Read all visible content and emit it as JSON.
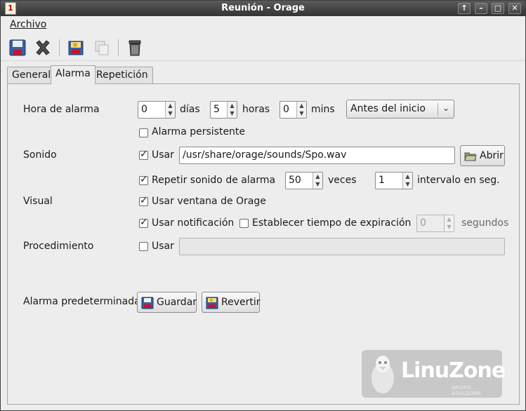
{
  "window": {
    "title": "Reunión - Orage"
  },
  "menubar": {
    "archivo": "Archivo"
  },
  "toolbar": {
    "items": [
      "save-icon",
      "delete-icon",
      "duplicate-icon",
      "copy-icon",
      "trash-icon"
    ]
  },
  "tabs": [
    {
      "label": "General"
    },
    {
      "label": "Alarma"
    },
    {
      "label": "Repetición"
    }
  ],
  "alarm": {
    "hora_label": "Hora de alarma",
    "dias_value": "0",
    "dias_unit": "días",
    "horas_value": "5",
    "horas_unit": "horas",
    "mins_value": "0",
    "mins_unit": "mins",
    "when_option": "Antes del inicio",
    "persistente_label": "Alarma persistente"
  },
  "sound": {
    "label": "Sonido",
    "usar_label": "Usar",
    "file_path": "/usr/share/orage/sounds/Spo.wav",
    "abrir_label": "Abrir",
    "repeat_label": "Repetir sonido de alarma",
    "repeat_count": "50",
    "veces_label": "veces",
    "interval_value": "1",
    "interval_label": "intervalo en seg."
  },
  "visual": {
    "label": "Visual",
    "ventana_label": "Usar ventana de Orage",
    "notificacion_label": "Usar notificación",
    "expiracion_label": "Establecer tiempo de expiración",
    "expiracion_value": "0",
    "segundos_label": "segundos"
  },
  "procedure": {
    "label": "Procedimiento",
    "usar_label": "Usar",
    "command_value": ""
  },
  "defaults": {
    "label": "Alarma predeterminada",
    "guardar_label": "Guardar",
    "revertir_label": "Revertir"
  },
  "watermark": {
    "brand": "LinuZone",
    "sub": "GRUPO ADSLZONE"
  }
}
